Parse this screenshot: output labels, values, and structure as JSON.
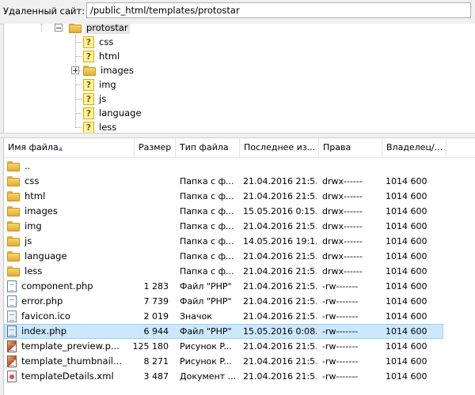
{
  "remote": {
    "label": "Удаленный сайт:",
    "path": "/public_html/templates/protostar"
  },
  "tree": {
    "root": "protostar",
    "children": [
      {
        "label": "css",
        "icon": "question-icon",
        "expandable": false
      },
      {
        "label": "html",
        "icon": "question-icon",
        "expandable": false
      },
      {
        "label": "images",
        "icon": "folder-icon",
        "expandable": true
      },
      {
        "label": "img",
        "icon": "question-icon",
        "expandable": false
      },
      {
        "label": "js",
        "icon": "question-icon",
        "expandable": false
      },
      {
        "label": "language",
        "icon": "question-icon",
        "expandable": false
      },
      {
        "label": "less",
        "icon": "question-icon",
        "expandable": false
      }
    ]
  },
  "columns": {
    "name": "Имя файла",
    "size": "Размер",
    "type": "Тип файла",
    "modified": "Последнее из...",
    "perms": "Права",
    "owner": "Владелец/..."
  },
  "files": [
    {
      "name": "..",
      "size": "",
      "type": "",
      "modified": "",
      "perms": "",
      "owner": "",
      "icon": "folder"
    },
    {
      "name": "css",
      "size": "",
      "type": "Папка с ф...",
      "modified": "21.04.2016 21:5...",
      "perms": "drwx------",
      "owner": "1014 600",
      "icon": "folder"
    },
    {
      "name": "html",
      "size": "",
      "type": "Папка с ф...",
      "modified": "21.04.2016 21:5...",
      "perms": "drwx------",
      "owner": "1014 600",
      "icon": "folder"
    },
    {
      "name": "images",
      "size": "",
      "type": "Папка с ф...",
      "modified": "15.05.2016 0:15...",
      "perms": "drwx------",
      "owner": "1014 600",
      "icon": "folder"
    },
    {
      "name": "img",
      "size": "",
      "type": "Папка с ф...",
      "modified": "21.04.2016 21:5...",
      "perms": "drwx------",
      "owner": "1014 600",
      "icon": "folder"
    },
    {
      "name": "js",
      "size": "",
      "type": "Папка с ф...",
      "modified": "14.05.2016 19:1...",
      "perms": "drwx------",
      "owner": "1014 600",
      "icon": "folder"
    },
    {
      "name": "language",
      "size": "",
      "type": "Папка с ф...",
      "modified": "21.04.2016 21:5...",
      "perms": "drwx------",
      "owner": "1014 600",
      "icon": "folder"
    },
    {
      "name": "less",
      "size": "",
      "type": "Папка с ф...",
      "modified": "21.04.2016 21:5...",
      "perms": "drwx------",
      "owner": "1014 600",
      "icon": "folder"
    },
    {
      "name": "component.php",
      "size": "1 283",
      "type": "Файл \"PHP\"",
      "modified": "21.04.2016 21:5...",
      "perms": "-rw-------",
      "owner": "1014 600",
      "icon": "php"
    },
    {
      "name": "error.php",
      "size": "7 739",
      "type": "Файл \"PHP\"",
      "modified": "21.04.2016 21:5...",
      "perms": "-rw-------",
      "owner": "1014 600",
      "icon": "php"
    },
    {
      "name": "favicon.ico",
      "size": "2 019",
      "type": "Значок",
      "modified": "21.04.2016 21:5...",
      "perms": "-rw-------",
      "owner": "1014 600",
      "icon": "ico"
    },
    {
      "name": "index.php",
      "size": "6 944",
      "type": "Файл \"PHP\"",
      "modified": "15.05.2016 0:08...",
      "perms": "-rw-------",
      "owner": "1014 600",
      "icon": "php",
      "selected": true
    },
    {
      "name": "template_preview.p...",
      "size": "125 180",
      "type": "Рисунок P...",
      "modified": "21.04.2016 21:5...",
      "perms": "-rw-------",
      "owner": "1014 600",
      "icon": "img"
    },
    {
      "name": "template_thumbnail...",
      "size": "8 271",
      "type": "Рисунок P...",
      "modified": "21.04.2016 21:5...",
      "perms": "-rw-------",
      "owner": "1014 600",
      "icon": "img"
    },
    {
      "name": "templateDetails.xml",
      "size": "3 487",
      "type": "Документ ...",
      "modified": "21.04.2016 21:5...",
      "perms": "-rw-------",
      "owner": "1014 600",
      "icon": "xml"
    }
  ]
}
